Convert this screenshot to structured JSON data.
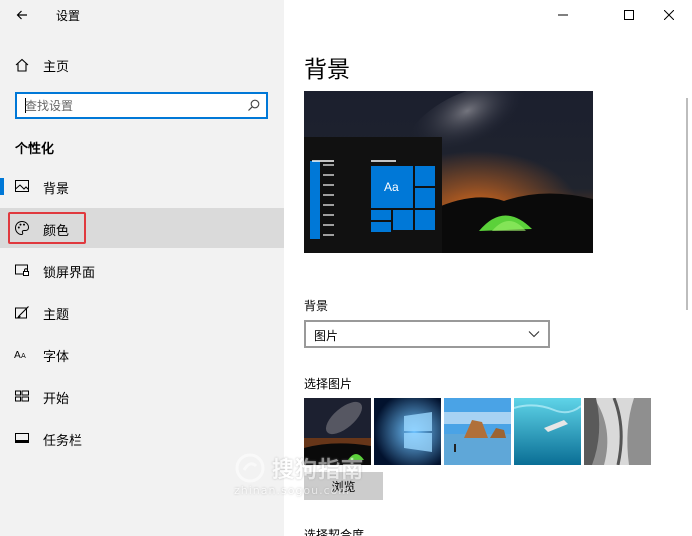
{
  "window": {
    "title": "设置",
    "controls": {
      "minimize": "minimize-icon",
      "maximize": "maximize-icon",
      "close": "close-icon"
    }
  },
  "sidebar": {
    "home_label": "主页",
    "search": {
      "placeholder": "查找设置",
      "value": ""
    },
    "section_title": "个性化",
    "items": [
      {
        "label": "背景",
        "icon": "image-icon",
        "selected": true
      },
      {
        "label": "颜色",
        "icon": "palette-icon",
        "hovered": true,
        "highlighted": true
      },
      {
        "label": "锁屏界面",
        "icon": "lock-screen-icon"
      },
      {
        "label": "主题",
        "icon": "theme-brush-icon"
      },
      {
        "label": "字体",
        "icon": "font-icon"
      },
      {
        "label": "开始",
        "icon": "start-icon"
      },
      {
        "label": "任务栏",
        "icon": "taskbar-icon"
      }
    ]
  },
  "main": {
    "page_title": "背景",
    "preview_tile_text": "Aa",
    "background_label": "背景",
    "background_dropdown_value": "图片",
    "choose_picture_label": "选择图片",
    "browse_label": "浏览",
    "fit_label": "选择契合度"
  },
  "watermark": {
    "text": "搜狗指南",
    "url": "zhinan.sogou.com"
  },
  "colors": {
    "accent": "#0078d7",
    "highlight_border": "#e0393e",
    "sidebar_bg": "#f2f2f2",
    "hover_bg": "#dadada"
  }
}
